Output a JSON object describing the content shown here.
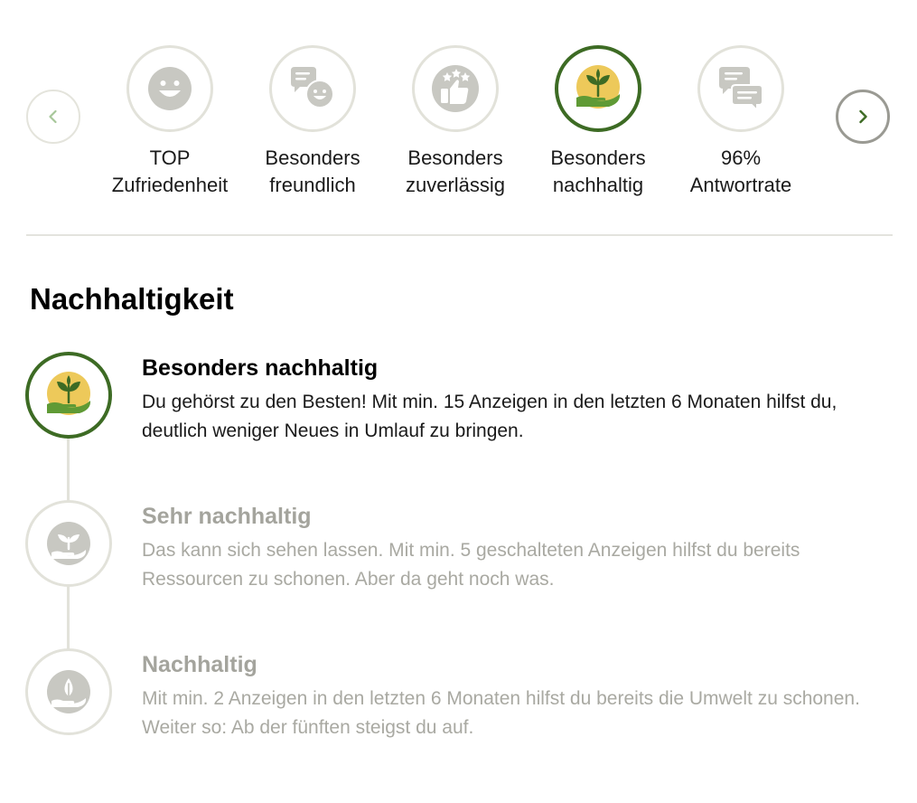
{
  "carousel": {
    "prev_icon": "chevron-left-icon",
    "next_icon": "chevron-right-icon",
    "badges": [
      {
        "line1": "TOP",
        "line2": "Zufriedenheit",
        "icon": "smiley-face-icon",
        "active": false
      },
      {
        "line1": "Besonders",
        "line2": "freundlich",
        "icon": "chat-bubbles-icon",
        "active": false
      },
      {
        "line1": "Besonders",
        "line2": "zuverlässig",
        "icon": "thumbs-up-stars-icon",
        "active": false
      },
      {
        "line1": "Besonders",
        "line2": "nachhaltig",
        "icon": "plant-in-hand-icon",
        "active": true
      },
      {
        "line1": "96%",
        "line2": "Antwortrate",
        "icon": "message-bubbles-icon",
        "active": false
      }
    ]
  },
  "section": {
    "title": "Nachhaltigkeit"
  },
  "levels": [
    {
      "title": "Besonders nachhaltig",
      "description": "Du gehörst zu den Besten! Mit min. 15 Anzeigen in den letzten 6 Monaten hilfst du, deutlich weniger Neues in Umlauf zu bringen.",
      "icon": "plant-in-hand-icon",
      "active": true
    },
    {
      "title": "Sehr nachhaltig",
      "description": "Das kann sich sehen lassen. Mit min. 5 geschalteten Anzeigen hilfst du bereits Ressourcen zu schonen. Aber da geht noch was.",
      "icon": "sprout-in-hand-icon",
      "active": false
    },
    {
      "title": "Nachhaltig",
      "description": "Mit min. 2 Anzeigen in den letzten 6 Monaten hilfst du bereits die Umwelt zu schonen. Weiter so: Ab der fünften steigst du auf.",
      "icon": "leaf-in-hand-icon",
      "active": false
    }
  ],
  "colors": {
    "accent_green": "#3d6b24",
    "leaf_green": "#5f9a35",
    "sun_yellow": "#edc95a",
    "inactive_border": "#e2e2da",
    "inactive_icon": "#c8c8c2",
    "inactive_text": "#a9a9a2"
  }
}
